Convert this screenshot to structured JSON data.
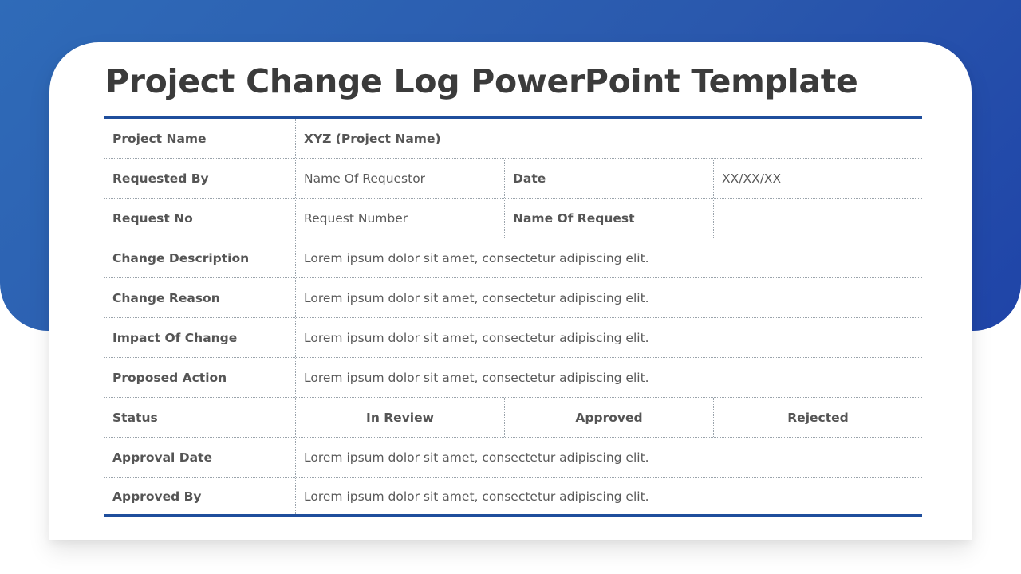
{
  "slide": {
    "title": "Project Change Log PowerPoint Template",
    "accent_color": "#1f4e9c",
    "background_color": "#2a58ad"
  },
  "table": {
    "project_name": {
      "label": "Project Name",
      "value": "XYZ (Project Name)"
    },
    "requested_by": {
      "label": "Requested By",
      "value": "Name Of Requestor",
      "date_label": "Date",
      "date_value": "XX/XX/XX"
    },
    "request_no": {
      "label": "Request No",
      "value": "Request Number",
      "name_label": "Name Of Request",
      "name_value": ""
    },
    "change_description": {
      "label": "Change Description",
      "value": "Lorem ipsum dolor sit amet, consectetur adipiscing elit."
    },
    "change_reason": {
      "label": "Change Reason",
      "value": "Lorem ipsum dolor sit amet, consectetur adipiscing elit."
    },
    "impact_of_change": {
      "label": "Impact Of Change",
      "value": "Lorem ipsum dolor sit amet, consectetur adipiscing elit."
    },
    "proposed_action": {
      "label": "Proposed Action",
      "value": "Lorem ipsum dolor sit amet, consectetur adipiscing elit."
    },
    "status": {
      "label": "Status",
      "options": [
        "In Review",
        "Approved",
        "Rejected"
      ]
    },
    "approval_date": {
      "label": "Approval Date",
      "value": "Lorem ipsum dolor sit amet, consectetur adipiscing elit."
    },
    "approved_by": {
      "label": "Approved By",
      "value": "Lorem ipsum dolor sit amet, consectetur adipiscing elit."
    }
  }
}
